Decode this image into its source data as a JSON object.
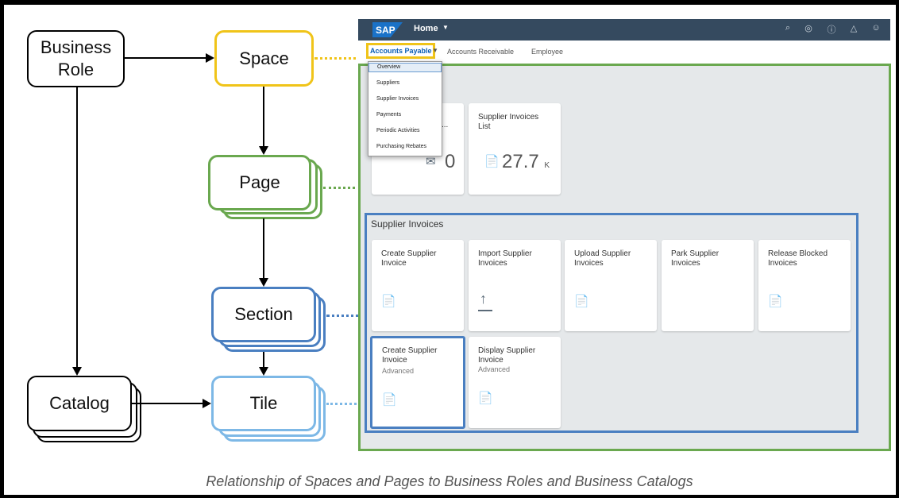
{
  "diagram": {
    "nodes": {
      "business_role": "Business\nRole",
      "space": "Space",
      "page": "Page",
      "section": "Section",
      "tile": "Tile",
      "catalog": "Catalog"
    },
    "colors": {
      "space": "#f0c419",
      "page": "#6aa84f",
      "section": "#4a7fc1",
      "tile": "#7db8e6",
      "neutral": "#000000"
    }
  },
  "sap": {
    "shell": {
      "logo": "SAP",
      "home_label": "Home",
      "icons": [
        "search-icon",
        "copilot-icon",
        "help-icon",
        "bell-icon",
        "user-icon"
      ]
    },
    "tabs": [
      "Accounts Payable",
      "Accounts Receivable",
      "Employee"
    ],
    "dropdown": [
      "Overview",
      "Suppliers",
      "Supplier Invoices",
      "Payments",
      "Periodic Activities",
      "Purchasing Rebates"
    ],
    "top_tiles": [
      {
        "title": "...",
        "kpi": "0",
        "unit": ""
      },
      {
        "title": "Supplier Invoices List",
        "kpi": "27.7",
        "unit": "K"
      }
    ],
    "section": {
      "title": "Supplier Invoices",
      "tiles": [
        {
          "title": "Create Supplier Invoice",
          "subtitle": "",
          "icon": "invoice-add-icon"
        },
        {
          "title": "Import Supplier Invoices",
          "subtitle": "",
          "icon": "upload-icon"
        },
        {
          "title": "Upload Supplier Invoices",
          "subtitle": "",
          "icon": "invoice-list-icon"
        },
        {
          "title": "Park Supplier Invoices",
          "subtitle": "",
          "icon": ""
        },
        {
          "title": "Release Blocked Invoices",
          "subtitle": "",
          "icon": "invoice-edit-icon"
        },
        {
          "title": "Create Supplier Invoice",
          "subtitle": "Advanced",
          "icon": "invoice-add-icon"
        },
        {
          "title": "Display Supplier Invoice",
          "subtitle": "Advanced",
          "icon": "invoice-display-icon"
        }
      ]
    }
  },
  "caption": "Relationship of Spaces and Pages to Business Roles and Business Catalogs"
}
